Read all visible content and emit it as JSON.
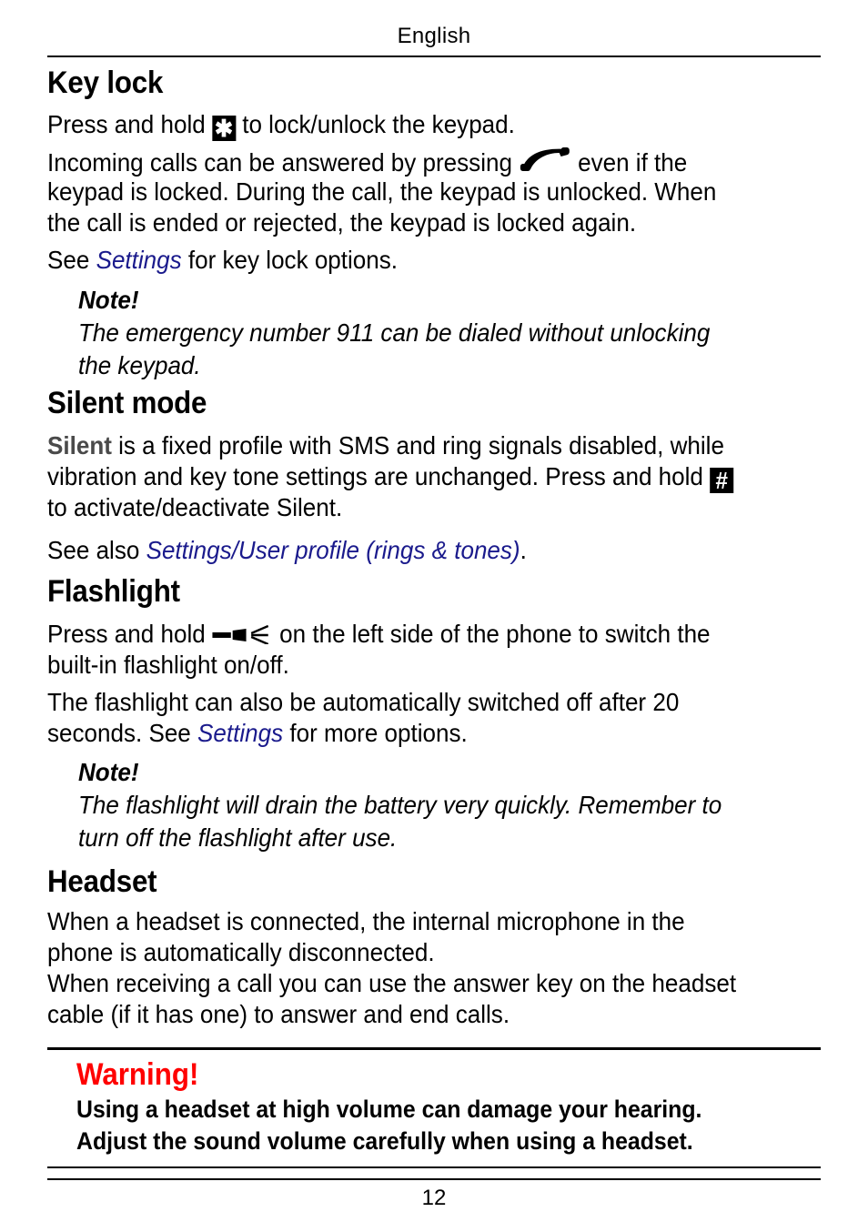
{
  "header": {
    "running_head": "English"
  },
  "sections": {
    "keylock": {
      "title": "Key lock",
      "p1_a": "Press and hold",
      "p1_key": "✱",
      "p1_b": "to lock/unlock the keypad.",
      "p2_a": "Incoming calls can be answered by pressing",
      "p2_b": "even if the",
      "p2_l2": "keypad is locked. During the call, the keypad is unlocked. When",
      "p2_l3": "the call is ended or rejected, the keypad is locked again.",
      "p3_a": "See",
      "p3_link": "Settings",
      "p3_b": "for key lock options.",
      "note_title": "Note!",
      "note_l1": "The emergency number 911 can be dialed without unlocking",
      "note_l2": "the keypad."
    },
    "silent": {
      "title": "Silent mode",
      "p1_bold": "Silent",
      "p1_a": "is a fixed profile with SMS and ring signals disabled, while",
      "p1_l2": "vibration and key tone settings are unchanged. Press and hold",
      "p1_key": "#",
      "p1_l3": "to activate/deactivate Silent.",
      "p2_a": "See also",
      "p2_link": "Settings/User profile (rings & tones)",
      "p2_b": "."
    },
    "flashlight": {
      "title": "Flashlight",
      "p1_a": "Press and hold",
      "p1_b": "on the left side of the phone to switch the",
      "p1_l2": "built-in flashlight on/off.",
      "p2_l1": "The flashlight can also be automatically switched off after 20",
      "p2_a": "seconds. See",
      "p2_link": "Settings",
      "p2_b": "for more options.",
      "note_title": "Note!",
      "note_l1": "The flashlight will drain the battery very quickly. Remember to",
      "note_l2": "turn off the flashlight after use."
    },
    "headset": {
      "title": "Headset",
      "l1": "When a headset is connected, the internal microphone in the",
      "l2": "phone is automatically disconnected.",
      "l3": "When receiving a call you can use the answer key on the headset",
      "l4": "cable (if it has one) to answer and end calls."
    }
  },
  "warning": {
    "title": "Warning!",
    "l1": "Using a headset at high volume can damage your hearing.",
    "l2": "Adjust the sound volume carefully when using a headset.",
    "color": "#ff0000"
  },
  "footer": {
    "page_number": "12"
  },
  "colors": {
    "link": "#1a1a8c",
    "emphasis_grey": "#4a4a4a"
  }
}
